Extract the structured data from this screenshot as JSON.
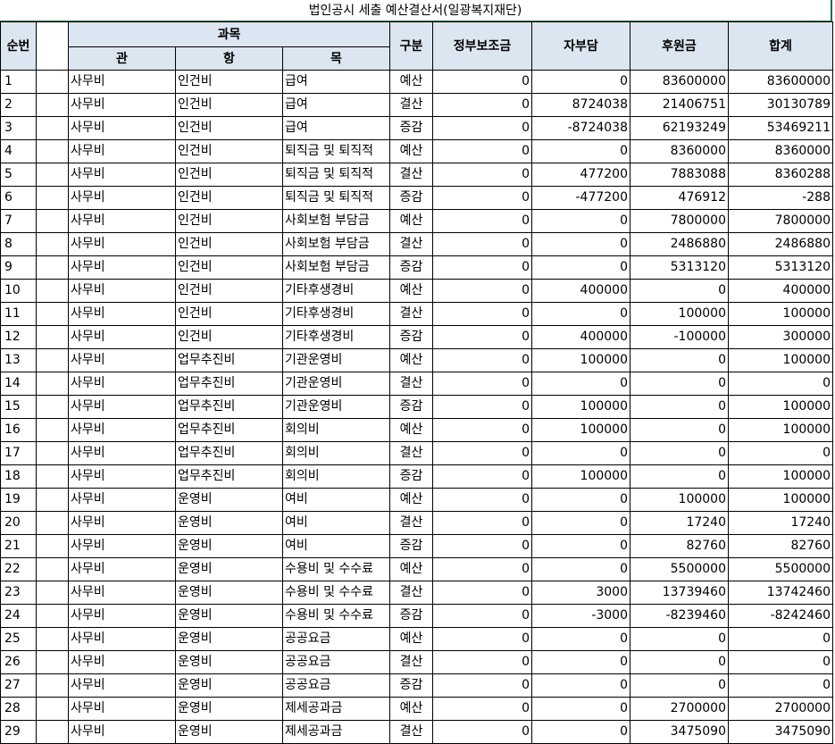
{
  "title": "법인공시 세출 예산결산서(일광복지재단)",
  "headers": {
    "no": "순번",
    "subject_group": "과목",
    "gwan": "관",
    "hang": "항",
    "mok": "목",
    "type": "구분",
    "gov": "정부보조금",
    "self": "자부담",
    "donation": "후원금",
    "total": "합계"
  },
  "rows": [
    {
      "no": "1",
      "gwan": "사무비",
      "hang": "인건비",
      "mok": "급여",
      "type": "예산",
      "gov": "0",
      "self": "0",
      "donation": "83600000",
      "total": "83600000"
    },
    {
      "no": "2",
      "gwan": "사무비",
      "hang": "인건비",
      "mok": "급여",
      "type": "결산",
      "gov": "0",
      "self": "8724038",
      "donation": "21406751",
      "total": "30130789"
    },
    {
      "no": "3",
      "gwan": "사무비",
      "hang": "인건비",
      "mok": "급여",
      "type": "증감",
      "gov": "0",
      "self": "-8724038",
      "donation": "62193249",
      "total": "53469211"
    },
    {
      "no": "4",
      "gwan": "사무비",
      "hang": "인건비",
      "mok": "퇴직금 및 퇴직적",
      "type": "예산",
      "gov": "0",
      "self": "0",
      "donation": "8360000",
      "total": "8360000"
    },
    {
      "no": "5",
      "gwan": "사무비",
      "hang": "인건비",
      "mok": "퇴직금 및 퇴직적",
      "type": "결산",
      "gov": "0",
      "self": "477200",
      "donation": "7883088",
      "total": "8360288"
    },
    {
      "no": "6",
      "gwan": "사무비",
      "hang": "인건비",
      "mok": "퇴직금 및 퇴직적",
      "type": "증감",
      "gov": "0",
      "self": "-477200",
      "donation": "476912",
      "total": "-288"
    },
    {
      "no": "7",
      "gwan": "사무비",
      "hang": "인건비",
      "mok": "사회보험 부담금",
      "type": "예산",
      "gov": "0",
      "self": "0",
      "donation": "7800000",
      "total": "7800000"
    },
    {
      "no": "8",
      "gwan": "사무비",
      "hang": "인건비",
      "mok": "사회보험 부담금",
      "type": "결산",
      "gov": "0",
      "self": "0",
      "donation": "2486880",
      "total": "2486880"
    },
    {
      "no": "9",
      "gwan": "사무비",
      "hang": "인건비",
      "mok": "사회보험 부담금",
      "type": "증감",
      "gov": "0",
      "self": "0",
      "donation": "5313120",
      "total": "5313120"
    },
    {
      "no": "10",
      "gwan": "사무비",
      "hang": "인건비",
      "mok": "기타후생경비",
      "type": "예산",
      "gov": "0",
      "self": "400000",
      "donation": "0",
      "total": "400000"
    },
    {
      "no": "11",
      "gwan": "사무비",
      "hang": "인건비",
      "mok": "기타후생경비",
      "type": "결산",
      "gov": "0",
      "self": "0",
      "donation": "100000",
      "total": "100000"
    },
    {
      "no": "12",
      "gwan": "사무비",
      "hang": "인건비",
      "mok": "기타후생경비",
      "type": "증감",
      "gov": "0",
      "self": "400000",
      "donation": "-100000",
      "total": "300000"
    },
    {
      "no": "13",
      "gwan": "사무비",
      "hang": "업무추진비",
      "mok": "기관운영비",
      "type": "예산",
      "gov": "0",
      "self": "100000",
      "donation": "0",
      "total": "100000"
    },
    {
      "no": "14",
      "gwan": "사무비",
      "hang": "업무추진비",
      "mok": "기관운영비",
      "type": "결산",
      "gov": "0",
      "self": "0",
      "donation": "0",
      "total": "0"
    },
    {
      "no": "15",
      "gwan": "사무비",
      "hang": "업무추진비",
      "mok": "기관운영비",
      "type": "증감",
      "gov": "0",
      "self": "100000",
      "donation": "0",
      "total": "100000"
    },
    {
      "no": "16",
      "gwan": "사무비",
      "hang": "업무추진비",
      "mok": "회의비",
      "type": "예산",
      "gov": "0",
      "self": "100000",
      "donation": "0",
      "total": "100000"
    },
    {
      "no": "17",
      "gwan": "사무비",
      "hang": "업무추진비",
      "mok": "회의비",
      "type": "결산",
      "gov": "0",
      "self": "0",
      "donation": "0",
      "total": "0"
    },
    {
      "no": "18",
      "gwan": "사무비",
      "hang": "업무추진비",
      "mok": "회의비",
      "type": "증감",
      "gov": "0",
      "self": "100000",
      "donation": "0",
      "total": "100000"
    },
    {
      "no": "19",
      "gwan": "사무비",
      "hang": "운영비",
      "mok": "여비",
      "type": "예산",
      "gov": "0",
      "self": "0",
      "donation": "100000",
      "total": "100000"
    },
    {
      "no": "20",
      "gwan": "사무비",
      "hang": "운영비",
      "mok": "여비",
      "type": "결산",
      "gov": "0",
      "self": "0",
      "donation": "17240",
      "total": "17240"
    },
    {
      "no": "21",
      "gwan": "사무비",
      "hang": "운영비",
      "mok": "여비",
      "type": "증감",
      "gov": "0",
      "self": "0",
      "donation": "82760",
      "total": "82760"
    },
    {
      "no": "22",
      "gwan": "사무비",
      "hang": "운영비",
      "mok": "수용비 및 수수료",
      "type": "예산",
      "gov": "0",
      "self": "0",
      "donation": "5500000",
      "total": "5500000"
    },
    {
      "no": "23",
      "gwan": "사무비",
      "hang": "운영비",
      "mok": "수용비 및 수수료",
      "type": "결산",
      "gov": "0",
      "self": "3000",
      "donation": "13739460",
      "total": "13742460"
    },
    {
      "no": "24",
      "gwan": "사무비",
      "hang": "운영비",
      "mok": "수용비 및 수수료",
      "type": "증감",
      "gov": "0",
      "self": "-3000",
      "donation": "-8239460",
      "total": "-8242460"
    },
    {
      "no": "25",
      "gwan": "사무비",
      "hang": "운영비",
      "mok": "공공요금",
      "type": "예산",
      "gov": "0",
      "self": "0",
      "donation": "0",
      "total": "0"
    },
    {
      "no": "26",
      "gwan": "사무비",
      "hang": "운영비",
      "mok": "공공요금",
      "type": "결산",
      "gov": "0",
      "self": "0",
      "donation": "0",
      "total": "0"
    },
    {
      "no": "27",
      "gwan": "사무비",
      "hang": "운영비",
      "mok": "공공요금",
      "type": "증감",
      "gov": "0",
      "self": "0",
      "donation": "0",
      "total": "0"
    },
    {
      "no": "28",
      "gwan": "사무비",
      "hang": "운영비",
      "mok": "제세공과금",
      "type": "예산",
      "gov": "0",
      "self": "0",
      "donation": "2700000",
      "total": "2700000"
    },
    {
      "no": "29",
      "gwan": "사무비",
      "hang": "운영비",
      "mok": "제세공과금",
      "type": "결산",
      "gov": "0",
      "self": "0",
      "donation": "3475090",
      "total": "3475090"
    }
  ]
}
